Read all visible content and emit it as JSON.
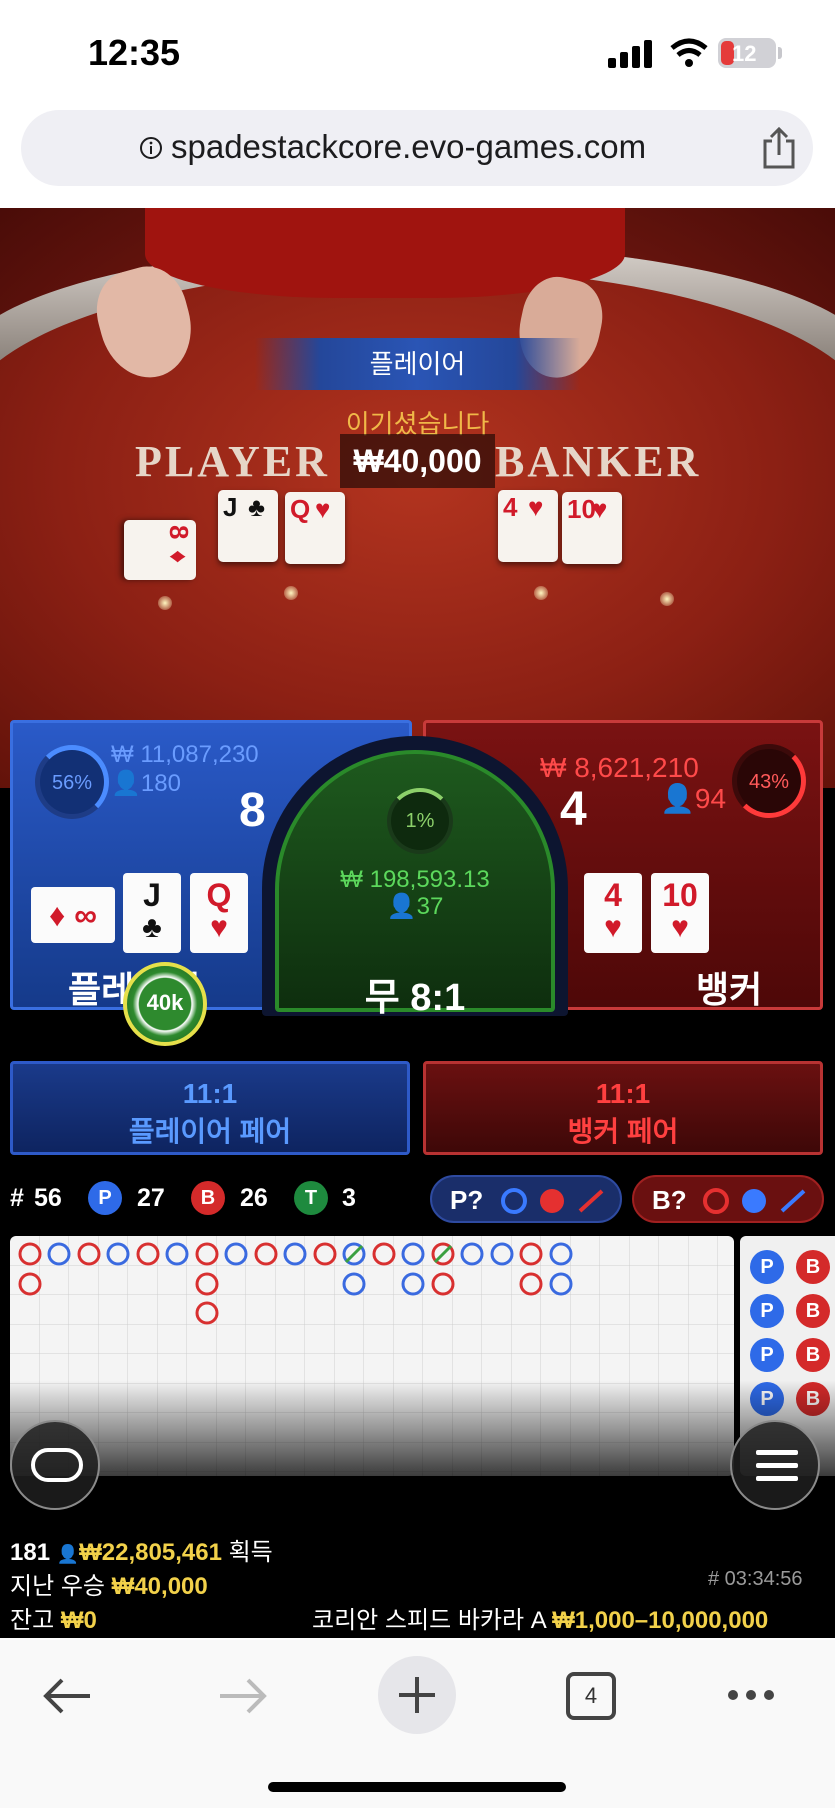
{
  "status": {
    "time": "12:35",
    "battery": "12"
  },
  "browser": {
    "url": "spadestackcore.evo-games.com",
    "tab_count": "4"
  },
  "video": {
    "winner_banner": "플레이어",
    "win_message": "이기셨습니다",
    "win_amount": "₩40,000",
    "table_player": "PLAYER",
    "table_banker": "BANKER"
  },
  "player": {
    "percent": "56%",
    "amount": "₩ 11,087,230",
    "count": "180",
    "score": "8",
    "label": "플레이어",
    "cards": [
      {
        "rank": "∞",
        "suit": "♦"
      },
      {
        "rank": "J",
        "suit": "♣"
      },
      {
        "rank": "Q",
        "suit": "♥"
      }
    ],
    "chip": "40k"
  },
  "banker": {
    "percent": "43%",
    "amount": "₩ 8,621,210",
    "count": "94",
    "score": "4",
    "label": "뱅커",
    "cards": [
      {
        "rank": "4",
        "suit": "♥"
      },
      {
        "rank": "10",
        "suit": "♥"
      }
    ]
  },
  "tie": {
    "percent": "1%",
    "amount": "₩ 198,593.13",
    "count": "37",
    "label": "무 8:1"
  },
  "pairs": {
    "player": {
      "odds": "11:1",
      "label": "플레이어 페어"
    },
    "banker": {
      "odds": "11:1",
      "label": "뱅커 페어"
    }
  },
  "stats": {
    "round_prefix": "#",
    "round": "56",
    "p": "27",
    "b": "26",
    "t": "3",
    "p_label": "P",
    "b_label": "B",
    "t_label": "T",
    "p_predict": "P?",
    "b_predict": "B?"
  },
  "roadmap": {
    "side_labels": [
      "P",
      "P",
      "P",
      "P"
    ],
    "side_labels_b": [
      "B",
      "B",
      "B",
      "B"
    ]
  },
  "footer": {
    "online": "181",
    "won_total": "₩22,805,461",
    "won_label": "획득",
    "last_win_label": "지난 우승",
    "last_win": "₩40,000",
    "balance_label": "잔고",
    "balance": "₩0",
    "game_id": "# 03:34:56",
    "table_name": "코리안 스피드 바카라 A",
    "limits": "₩1,000–10,000,000"
  },
  "colors": {
    "player": "#2a5ac8",
    "banker": "#7a1212",
    "tie": "#1e5a1e",
    "gold": "#f2d14a"
  }
}
